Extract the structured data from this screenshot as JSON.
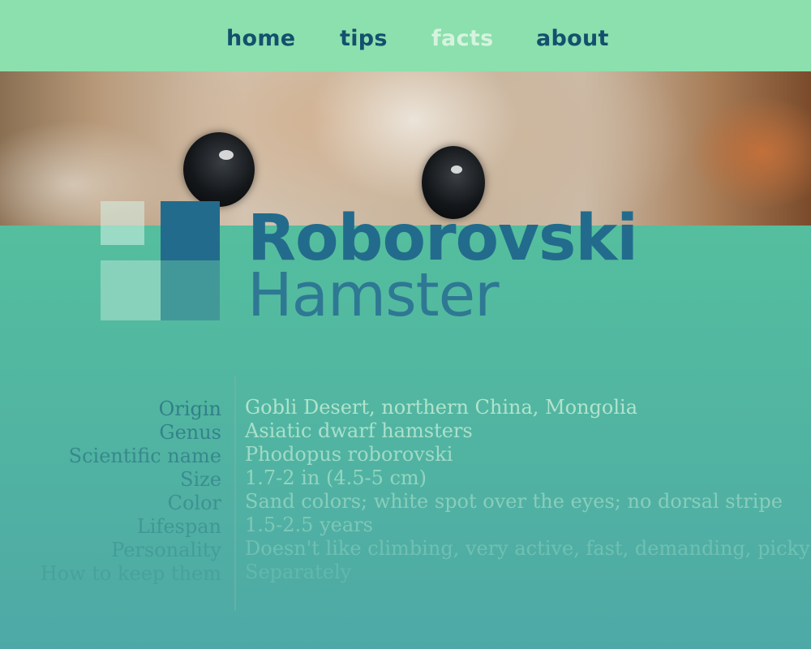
{
  "nav": {
    "items": [
      {
        "label": "home",
        "active": false
      },
      {
        "label": "tips",
        "active": false
      },
      {
        "label": "facts",
        "active": true
      },
      {
        "label": "about",
        "active": false
      }
    ]
  },
  "page": {
    "title_line1": "Roborovski",
    "title_line2": "Hamster"
  },
  "facts": [
    {
      "label": "Origin",
      "value": "Gobli Desert, northern China, Mongolia"
    },
    {
      "label": "Genus",
      "value": "Asiatic dwarf hamsters"
    },
    {
      "label": "Scientific name",
      "value": "Phodopus roborovski"
    },
    {
      "label": "Size",
      "value": "1.7-2 in (4.5-5 cm)"
    },
    {
      "label": "Color",
      "value": "Sand colors; white spot over the eyes; no dorsal stripe"
    },
    {
      "label": "Lifespan",
      "value": "1.5-2.5 years"
    },
    {
      "label": "Personality",
      "value": "Doesn't like climbing, very active, fast, demanding, picky"
    },
    {
      "label": "How to keep them",
      "value": "Separately"
    }
  ],
  "colors": {
    "nav_bg": "#8be0ad",
    "nav_text": "#14506e",
    "nav_active": "#d6f3df",
    "title": "#236b8c",
    "fact_label_text": "#2f7c86",
    "fact_value_text": "#b6e6cf"
  }
}
